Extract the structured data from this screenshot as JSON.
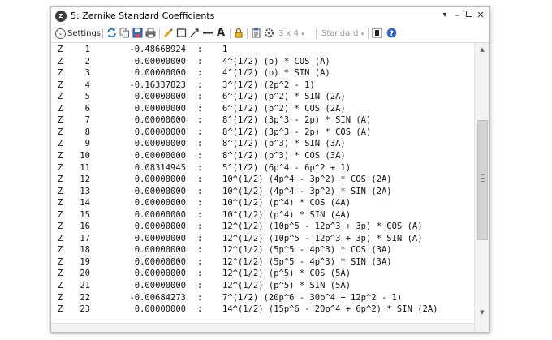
{
  "window": {
    "title": "5: Zernike Standard Coefficients",
    "app_icon": "zemax-logo",
    "controls": [
      "chevron-down-icon",
      "minimize-icon",
      "restore-icon",
      "close-icon"
    ]
  },
  "toolbar": {
    "settings_label": "Settings",
    "layout_label": "3 x 4",
    "layout_options_icon": "chevron-down-icon",
    "standard_label": "Standard",
    "icons": [
      "refresh-icon",
      "copy-icon",
      "save-icon",
      "print-icon",
      "pencil-icon",
      "rectangle-icon",
      "arrow-line-icon",
      "line-icon",
      "text-icon",
      "lock-icon",
      "clipboard-icon",
      "settings-wheel-icon",
      "color-swatch-icon",
      "help-icon"
    ]
  },
  "rows": [
    {
      "z": "Z",
      "n": "1",
      "value": "-0.48668924",
      "colon": ":",
      "formula": "1"
    },
    {
      "z": "Z",
      "n": "2",
      "value": "0.00000000",
      "colon": ":",
      "formula": "4^(1/2) (p) * COS (A)"
    },
    {
      "z": "Z",
      "n": "3",
      "value": "0.00000000",
      "colon": ":",
      "formula": "4^(1/2) (p) * SIN (A)"
    },
    {
      "z": "Z",
      "n": "4",
      "value": "-0.16337823",
      "colon": ":",
      "formula": "3^(1/2) (2p^2 - 1)"
    },
    {
      "z": "Z",
      "n": "5",
      "value": "0.00000000",
      "colon": ":",
      "formula": "6^(1/2) (p^2) * SIN (2A)"
    },
    {
      "z": "Z",
      "n": "6",
      "value": "0.00000000",
      "colon": ":",
      "formula": "6^(1/2) (p^2) * COS (2A)"
    },
    {
      "z": "Z",
      "n": "7",
      "value": "0.00000000",
      "colon": ":",
      "formula": "8^(1/2) (3p^3 - 2p) * SIN (A)"
    },
    {
      "z": "Z",
      "n": "8",
      "value": "0.00000000",
      "colon": ":",
      "formula": "8^(1/2) (3p^3 - 2p) * COS (A)"
    },
    {
      "z": "Z",
      "n": "9",
      "value": "0.00000000",
      "colon": ":",
      "formula": "8^(1/2) (p^3) * SIN (3A)"
    },
    {
      "z": "Z",
      "n": "10",
      "value": "0.00000000",
      "colon": ":",
      "formula": "8^(1/2) (p^3) * COS (3A)"
    },
    {
      "z": "Z",
      "n": "11",
      "value": "0.08314945",
      "colon": ":",
      "formula": "5^(1/2) (6p^4 - 6p^2 + 1)"
    },
    {
      "z": "Z",
      "n": "12",
      "value": "0.00000000",
      "colon": ":",
      "formula": "10^(1/2) (4p^4 - 3p^2) * COS (2A)"
    },
    {
      "z": "Z",
      "n": "13",
      "value": "0.00000000",
      "colon": ":",
      "formula": "10^(1/2) (4p^4 - 3p^2) * SIN (2A)"
    },
    {
      "z": "Z",
      "n": "14",
      "value": "0.00000000",
      "colon": ":",
      "formula": "10^(1/2) (p^4) * COS (4A)"
    },
    {
      "z": "Z",
      "n": "15",
      "value": "0.00000000",
      "colon": ":",
      "formula": "10^(1/2) (p^4) * SIN (4A)"
    },
    {
      "z": "Z",
      "n": "16",
      "value": "0.00000000",
      "colon": ":",
      "formula": "12^(1/2) (10p^5 - 12p^3 + 3p) * COS (A)"
    },
    {
      "z": "Z",
      "n": "17",
      "value": "0.00000000",
      "colon": ":",
      "formula": "12^(1/2) (10p^5 - 12p^3 + 3p) * SIN (A)"
    },
    {
      "z": "Z",
      "n": "18",
      "value": "0.00000000",
      "colon": ":",
      "formula": "12^(1/2) (5p^5 - 4p^3) * COS (3A)"
    },
    {
      "z": "Z",
      "n": "19",
      "value": "0.00000000",
      "colon": ":",
      "formula": "12^(1/2) (5p^5 - 4p^3) * SIN (3A)"
    },
    {
      "z": "Z",
      "n": "20",
      "value": "0.00000000",
      "colon": ":",
      "formula": "12^(1/2) (p^5) * COS (5A)"
    },
    {
      "z": "Z",
      "n": "21",
      "value": "0.00000000",
      "colon": ":",
      "formula": "12^(1/2) (p^5) * SIN (5A)"
    },
    {
      "z": "Z",
      "n": "22",
      "value": "-0.00684273",
      "colon": ":",
      "formula": "7^(1/2) (20p^6 - 30p^4 + 12p^2 - 1)"
    },
    {
      "z": "Z",
      "n": "23",
      "value": "0.00000000",
      "colon": ":",
      "formula": "14^(1/2) (15p^6 - 20p^4 + 6p^2) * SIN (2A)"
    }
  ],
  "scrollbar": {
    "up_icon": "scroll-up-icon",
    "down_icon": "scroll-down-icon",
    "position_fraction": 0.5
  }
}
